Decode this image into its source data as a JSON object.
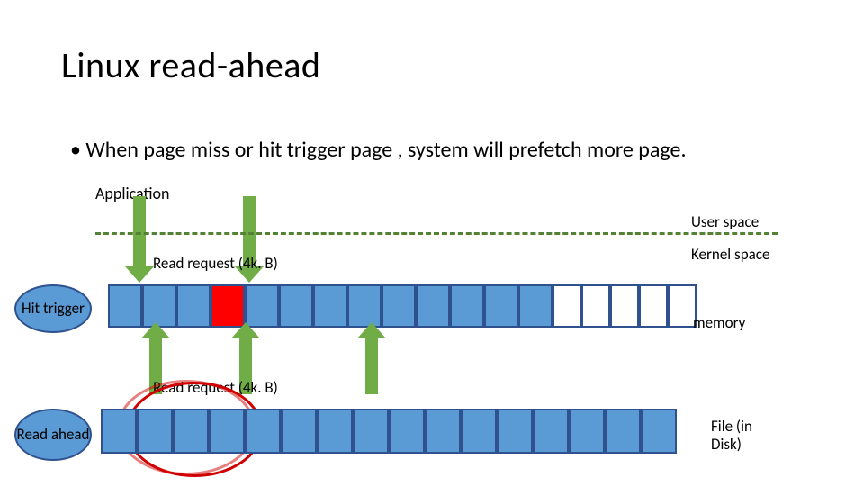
{
  "title": "Linux read-ahead",
  "bullet": "When page miss or hit trigger page , system will prefetch more page.",
  "labels": {
    "application": "Application",
    "user_space": "User space",
    "kernel_space": "Kernel space",
    "read_request": "Read request (4k. B)",
    "memory": "memory",
    "disk": "File (in Disk)"
  },
  "callouts": {
    "hit_trigger": "Hit trigger",
    "read_ahead": "Read ahead"
  },
  "memory_row": {
    "cell_count": 18,
    "colors": [
      "blue",
      "blue",
      "blue",
      "red",
      "blue",
      "blue",
      "blue",
      "blue",
      "blue",
      "blue",
      "blue",
      "blue",
      "blue",
      "white",
      "white",
      "white",
      "white",
      "white"
    ]
  },
  "disk_row": {
    "cell_count": 16,
    "colors": [
      "blue",
      "blue",
      "blue",
      "blue",
      "blue",
      "blue",
      "blue",
      "blue",
      "blue",
      "blue",
      "blue",
      "blue",
      "blue",
      "blue",
      "blue",
      "blue"
    ]
  },
  "arrows": {
    "down": 2,
    "up": 3
  },
  "divider": {
    "style": "dashed",
    "color": "#548235"
  },
  "colors": {
    "blue": "#5b9bd5",
    "red": "#ff0000",
    "arrow": "#70ad47",
    "border": "#2f528f",
    "circle": "#d00000"
  }
}
